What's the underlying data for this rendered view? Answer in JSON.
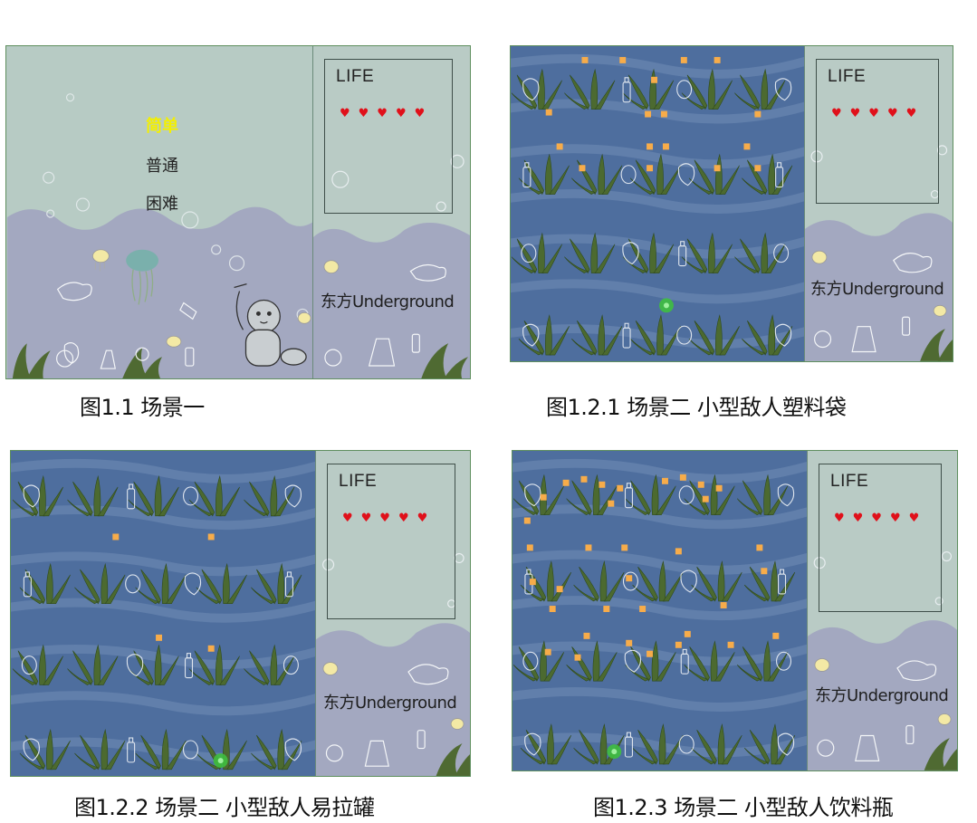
{
  "side_panel": {
    "life_label": "LIFE",
    "hearts": "♥♥♥♥♥",
    "brand": "东方Underground"
  },
  "scene1": {
    "menu": {
      "easy": "简单",
      "normal": "普通",
      "hard": "困难"
    },
    "caption": "图1.1 场景一"
  },
  "scene2_bag": {
    "caption": "图1.2.1 场景二 小型敌人塑料袋"
  },
  "scene2_can": {
    "caption": "图1.2.2 场景二 小型敌人易拉罐"
  },
  "scene2_bottle": {
    "caption": "图1.2.3 场景二 小型敌人饮料瓶"
  },
  "colors": {
    "sea_light": "#b7cbc4",
    "sea_sand": "#a3a8c0",
    "water_deep": "#4e6e9e",
    "heart": "#e0101a",
    "bullet": "#f7ac4a",
    "selected": "#f4f000",
    "player": "#3fbf3f"
  },
  "icons": [
    "seaweed-icon",
    "jellyfish-icon",
    "plastic-bag-icon",
    "bottle-icon",
    "can-icon",
    "bubble-icon",
    "diver-robot-icon",
    "heart-icon",
    "player-orb-icon"
  ]
}
